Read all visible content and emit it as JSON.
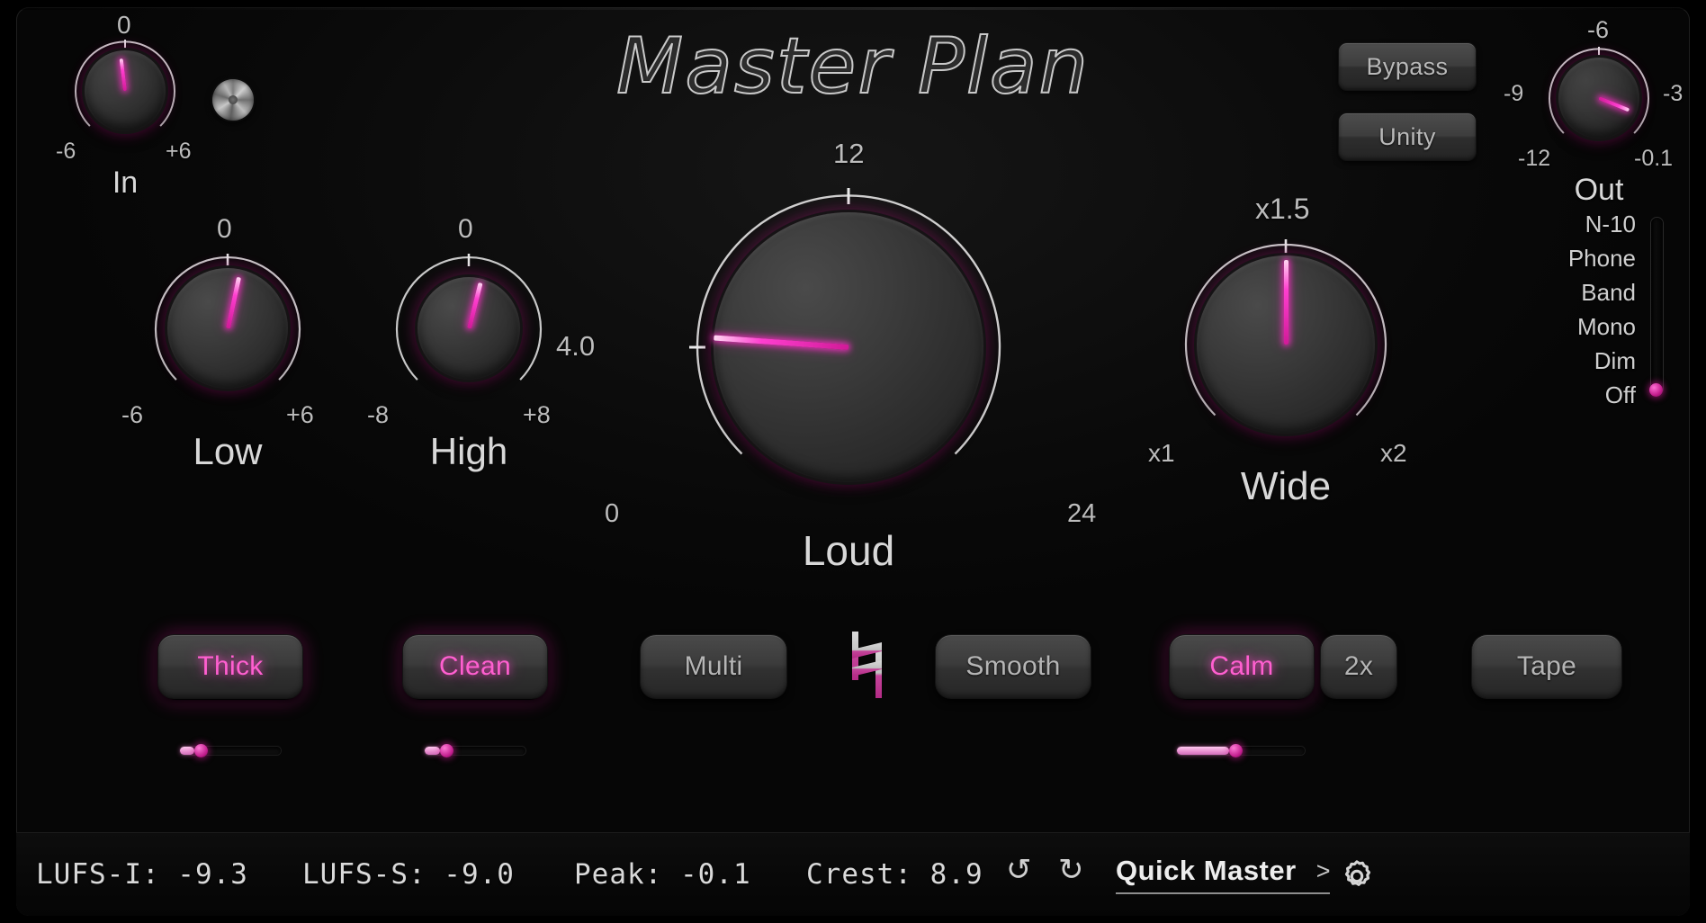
{
  "app": {
    "title": "Master Plan"
  },
  "header": {
    "in_knob": {
      "name": "In",
      "min_label": "-6",
      "mid_label": "0",
      "max_label": "+6",
      "value_angle_deg": -7
    },
    "out_knob": {
      "name": "Out",
      "labels": [
        "-12",
        "-9",
        "-6",
        "-3",
        "-0.1"
      ],
      "value_angle_deg": 112
    },
    "buttons": [
      {
        "label": "Bypass",
        "name": "bypass-button",
        "active": false
      },
      {
        "label": "Unity",
        "name": "unity-button",
        "active": false
      }
    ],
    "screw": {
      "name": "trim-screw"
    }
  },
  "knobs": [
    {
      "id": "low",
      "label": "Low",
      "ticks": {
        "min": "-6",
        "mid": "0",
        "max": "+6"
      },
      "angle_deg": 12
    },
    {
      "id": "high",
      "label": "High",
      "ticks": {
        "min": "-8",
        "mid": "0",
        "max": "+8"
      },
      "angle_deg": 14
    },
    {
      "id": "loud",
      "label": "Loud",
      "ticks": {
        "min": "0",
        "left": "4.0",
        "mid": "12",
        "max": "24"
      },
      "angle_deg": -86
    },
    {
      "id": "wide",
      "label": "Wide",
      "ticks": {
        "min": "x1",
        "mid": "x1.5",
        "max": "x2"
      },
      "angle_deg": 0
    }
  ],
  "monitor": {
    "name": "monitor-mode-selector",
    "items": [
      "N-10",
      "Phone",
      "Band",
      "Mono",
      "Dim",
      "Off"
    ],
    "selected": "Off"
  },
  "footer_buttons": [
    {
      "label": "Thick",
      "name": "thick-button",
      "active": true
    },
    {
      "label": "Clean",
      "name": "clean-button",
      "active": true
    },
    {
      "label": "Multi",
      "name": "multi-button",
      "active": false
    },
    {
      "label": "Smooth",
      "name": "smooth-button",
      "active": false
    },
    {
      "label": "Calm",
      "name": "calm-button",
      "active": true
    },
    {
      "label": "2x",
      "name": "oversample-button",
      "active": false
    },
    {
      "label": "Tape",
      "name": "tape-button",
      "active": false
    }
  ],
  "sliders": [
    {
      "name": "thick-amount-slider",
      "value_pct": 14
    },
    {
      "name": "clean-amount-slider",
      "value_pct": 15
    },
    {
      "name": "calm-amount-slider",
      "value_pct": 41
    }
  ],
  "natural_icon": {
    "name": "natural-sign-icon",
    "glyph": "♮"
  },
  "status": {
    "lufs_i": "LUFS-I: -9.3",
    "lufs_s": "LUFS-S: -9.0",
    "peak": "Peak: -0.1",
    "crest": "Crest: 8.9",
    "undo": "↺",
    "redo": "↻",
    "preset_name": "Quick Master",
    "preset_arrow": ">",
    "settings_icon": "gear-icon"
  },
  "colors": {
    "accent": "#d61a98",
    "accent_bright": "#ff5fd0",
    "panel": "#0e0e0e",
    "text": "#d8d8d8"
  }
}
